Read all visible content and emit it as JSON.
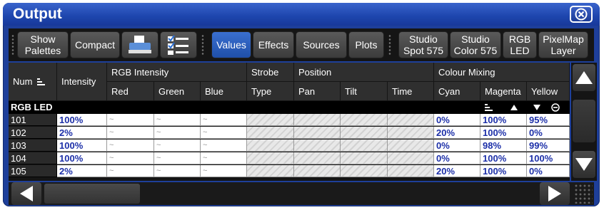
{
  "window": {
    "title": "Output"
  },
  "toolbar": {
    "show_palettes": "Show\nPalettes",
    "compact": "Compact",
    "print_icon": "printer-icon",
    "list_icon": "checklist-icon",
    "values": "Values",
    "effects": "Effects",
    "sources": "Sources",
    "plots": "Plots",
    "fixtures": [
      {
        "line1": "Studio",
        "line2": "Spot 575"
      },
      {
        "line1": "Studio",
        "line2": "Color 575"
      },
      {
        "line1": "RGB",
        "line2": "LED"
      },
      {
        "line1": "PixelMap",
        "line2": "Layer"
      }
    ]
  },
  "headers": {
    "num": "Num",
    "intensity": "Intensity",
    "groups": [
      "RGB Intensity",
      "Strobe",
      "Position",
      "Colour Mixing"
    ],
    "columns": [
      "Red",
      "Green",
      "Blue",
      "Type",
      "Pan",
      "Tilt",
      "Time",
      "Cyan",
      "Magenta",
      "Yellow"
    ]
  },
  "group_label": "RGB LED",
  "rows": [
    {
      "num": "101",
      "intensity": "100%",
      "cyan": "0%",
      "magenta": "100%",
      "yellow": "95%"
    },
    {
      "num": "102",
      "intensity": "2%",
      "cyan": "20%",
      "magenta": "100%",
      "yellow": "0%"
    },
    {
      "num": "103",
      "intensity": "100%",
      "cyan": "0%",
      "magenta": "98%",
      "yellow": "99%"
    },
    {
      "num": "104",
      "intensity": "100%",
      "cyan": "0%",
      "magenta": "100%",
      "yellow": "100%"
    },
    {
      "num": "105",
      "intensity": "2%",
      "cyan": "20%",
      "magenta": "100%",
      "yellow": "0%"
    }
  ],
  "tilde": "~",
  "colors": {
    "title_bar": "#1e3f9a",
    "selected": "#2f5fc0",
    "value_text": "#1c2fa8"
  }
}
